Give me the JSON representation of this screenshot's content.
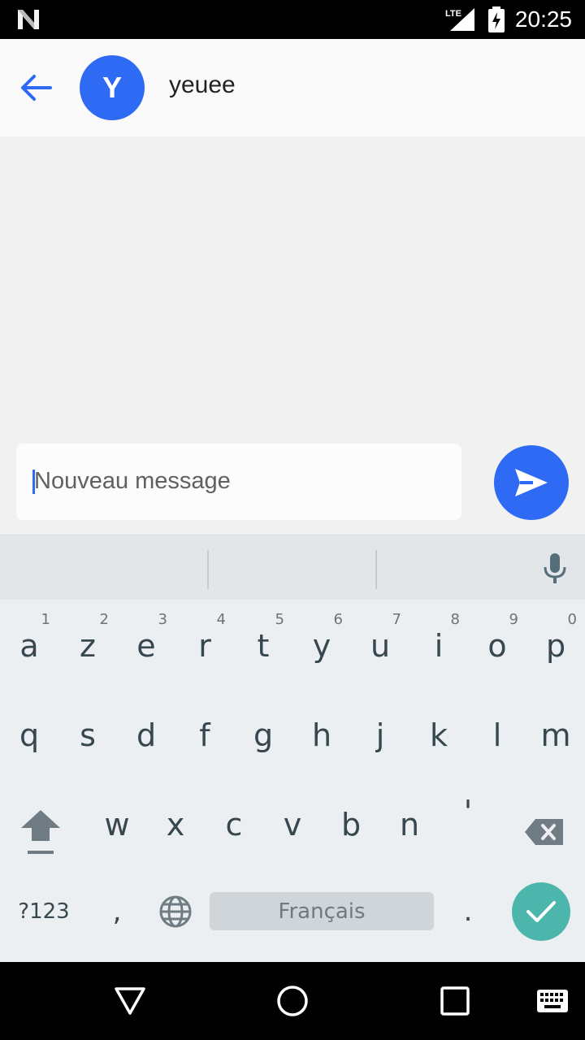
{
  "status_bar": {
    "network_label": "LTE",
    "time": "20:25",
    "icons": [
      "android-n-icon",
      "lte-signal-icon",
      "battery-charging-icon"
    ]
  },
  "header": {
    "back_icon": "arrow-back-icon",
    "avatar_letter": "Y",
    "contact_name": "yeuee",
    "accent_color": "#2f6af5"
  },
  "compose": {
    "placeholder": "Nouveau message",
    "send_icon": "send-icon"
  },
  "keyboard": {
    "suggestions": [
      "",
      "",
      ""
    ],
    "mic_icon": "mic-icon",
    "row1": [
      {
        "letter": "a",
        "hint": "1"
      },
      {
        "letter": "z",
        "hint": "2"
      },
      {
        "letter": "e",
        "hint": "3"
      },
      {
        "letter": "r",
        "hint": "4"
      },
      {
        "letter": "t",
        "hint": "5"
      },
      {
        "letter": "y",
        "hint": "6"
      },
      {
        "letter": "u",
        "hint": "7"
      },
      {
        "letter": "i",
        "hint": "8"
      },
      {
        "letter": "o",
        "hint": "9"
      },
      {
        "letter": "p",
        "hint": "0"
      }
    ],
    "row2": [
      "q",
      "s",
      "d",
      "f",
      "g",
      "h",
      "j",
      "k",
      "l",
      "m"
    ],
    "row3": [
      "w",
      "x",
      "c",
      "v",
      "b",
      "n",
      "'"
    ],
    "symbols_label": "?123",
    "comma_label": ",",
    "space_label": "Français",
    "period_label": ".",
    "enter_color": "#4db6ac"
  },
  "nav_bar": {
    "icons": [
      "back-triangle-icon",
      "home-circle-icon",
      "recents-square-icon",
      "keyboard-switch-icon"
    ]
  }
}
